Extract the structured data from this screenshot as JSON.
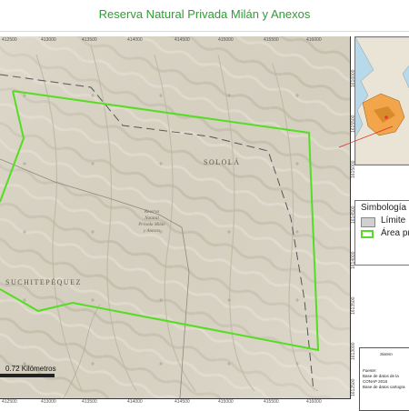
{
  "title": "Reserva Natural Privada Milán y Anexos",
  "map": {
    "department_labels": [
      "SOLOLÁ",
      "SUCHITEPÉQUEZ"
    ],
    "reserve_label_lines": [
      "Reserva",
      "Natural",
      "Privada Milán",
      "y Anexos"
    ],
    "x_ticks_top": [
      "412500",
      "413000",
      "413500",
      "414000",
      "414500",
      "415000",
      "415500",
      "416000"
    ],
    "x_ticks_bottom": [
      "412500",
      "413000",
      "413500",
      "414000",
      "414500",
      "415000",
      "415500",
      "416000"
    ],
    "y_ticks_right": [
      "1616000",
      "1615500",
      "1615000",
      "1614500",
      "1614000",
      "1613500",
      "1613000",
      "1612500"
    ],
    "colors": {
      "reserve_outline": "#55dd22",
      "boundary": "#555555",
      "terrain": "#d8d3c4"
    }
  },
  "scale_bar": {
    "label": "0.72 Kilómetros"
  },
  "legend": {
    "title": "Simbología",
    "items": [
      {
        "label": "Límite",
        "swatch": "gray-box"
      },
      {
        "label": "Área pr",
        "swatch": "green-outline"
      }
    ]
  },
  "notes": {
    "heading": "Sistem",
    "source_label": "Fuente:",
    "lines": [
      "Base de datos de la",
      "CONAP 2016",
      "Base de datos cartogra"
    ]
  }
}
